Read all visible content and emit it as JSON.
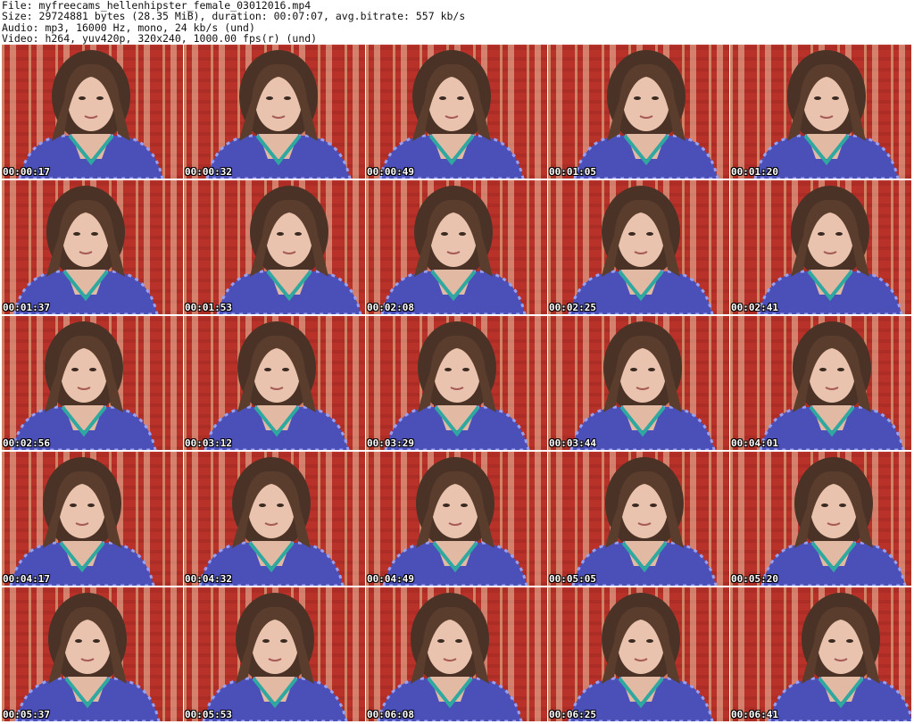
{
  "header": {
    "file": "File: myfreecams_hellenhipster_female_03012016.mp4",
    "size": "Size: 29724881 bytes (28.35 MiB), duration: 00:07:07, avg.bitrate: 557 kb/s",
    "audio": "Audio: mp3, 16000 Hz, mono, 24 kb/s (und)",
    "video": "Video: h264, yuv420p, 320x240, 1000.00 fps(r) (und)"
  },
  "thumbnails": [
    {
      "timestamp": "00:00:17"
    },
    {
      "timestamp": "00:00:32"
    },
    {
      "timestamp": "00:00:49"
    },
    {
      "timestamp": "00:01:05"
    },
    {
      "timestamp": "00:01:20"
    },
    {
      "timestamp": "00:01:37"
    },
    {
      "timestamp": "00:01:53"
    },
    {
      "timestamp": "00:02:08"
    },
    {
      "timestamp": "00:02:25"
    },
    {
      "timestamp": "00:02:41"
    },
    {
      "timestamp": "00:02:56"
    },
    {
      "timestamp": "00:03:12"
    },
    {
      "timestamp": "00:03:29"
    },
    {
      "timestamp": "00:03:44"
    },
    {
      "timestamp": "00:04:01"
    },
    {
      "timestamp": "00:04:17"
    },
    {
      "timestamp": "00:04:32"
    },
    {
      "timestamp": "00:04:49"
    },
    {
      "timestamp": "00:05:05"
    },
    {
      "timestamp": "00:05:20"
    },
    {
      "timestamp": "00:05:37"
    },
    {
      "timestamp": "00:05:53"
    },
    {
      "timestamp": "00:06:08"
    },
    {
      "timestamp": "00:06:25"
    },
    {
      "timestamp": "00:06:41"
    }
  ]
}
